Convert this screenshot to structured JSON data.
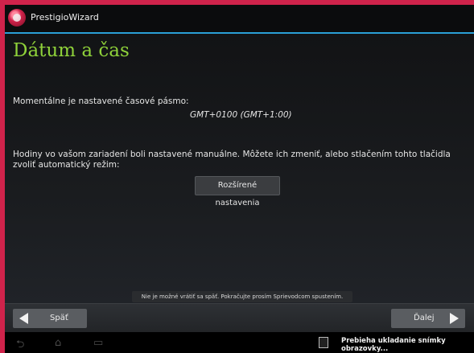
{
  "app": {
    "title": "PrestigioWizard"
  },
  "page": {
    "title": "Dátum a čas"
  },
  "timezone": {
    "label": "Momentálne je nastavené časové pásmo:",
    "value": "GMT+0100 (GMT+1:00)"
  },
  "manual": {
    "text": "Hodiny vo vašom zariadení boli nastavené manuálne. Môžete ich zmeniť, alebo stlačením tohto tlačidla zvoliť automatický režim:"
  },
  "buttons": {
    "advanced": "Rozšírené nastavenia",
    "back": "Späť",
    "next": "Ďalej"
  },
  "toast": "Nie je možné vrátiť sa späť. Pokračujte prosím Sprievodcom spustením.",
  "notification": "Prebieha ukladanie snímky obrazovky...",
  "colors": {
    "accent": "#2a9fd6",
    "title": "#8fd23a",
    "frame": "#d0234b"
  }
}
